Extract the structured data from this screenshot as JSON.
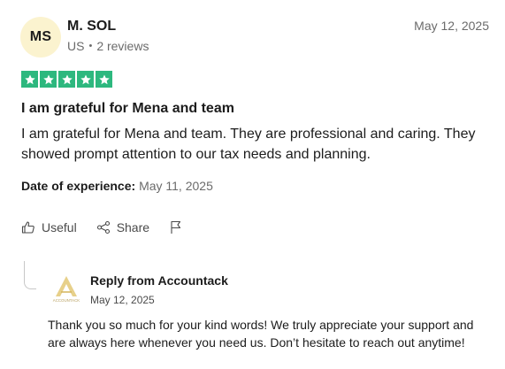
{
  "reviewer": {
    "initials": "MS",
    "name": "M. SOL",
    "country": "US",
    "reviews": "2 reviews",
    "review_date": "May 12, 2025"
  },
  "rating": {
    "stars": 5,
    "max": 5,
    "color": "#2db87e"
  },
  "review": {
    "title": "I am grateful for Mena and team",
    "body": "I am grateful for Mena and team. They are professional and caring. They showed prompt attention to our tax needs and planning.",
    "experience_label": "Date of experience:",
    "experience_date": "May 11, 2025"
  },
  "actions": {
    "useful_label": "Useful",
    "share_label": "Share",
    "useful_icon": "thumbs-up-icon",
    "share_icon": "share-icon",
    "report_icon": "flag-icon"
  },
  "reply": {
    "from": "Reply from Accountack",
    "date": "May 12, 2025",
    "text": "Thank you so much for your kind words! We truly appreciate your support and are always here whenever you need us. Don’t hesitate to reach out anytime!",
    "logo_text": "ACCOUNTACK",
    "logo_color": "#d4b45a"
  }
}
